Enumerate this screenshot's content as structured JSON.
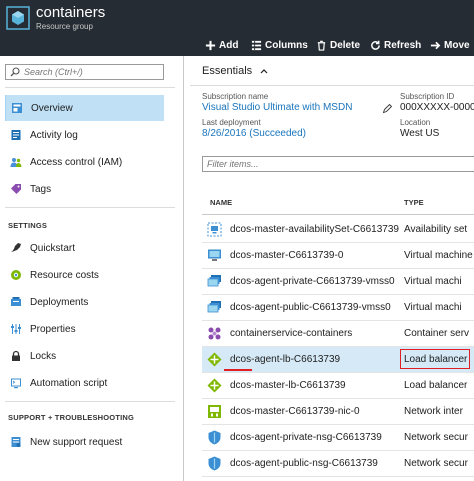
{
  "header": {
    "title": "containers",
    "subtitle": "Resource group",
    "toolbar": [
      {
        "label": "Add",
        "icon": "plus-icon"
      },
      {
        "label": "Columns",
        "icon": "columns-icon"
      },
      {
        "label": "Delete",
        "icon": "trash-icon"
      },
      {
        "label": "Refresh",
        "icon": "refresh-icon"
      },
      {
        "label": "Move",
        "icon": "arrow-right-icon"
      }
    ]
  },
  "sidebar": {
    "search_placeholder": "Search (Ctrl+/)",
    "items_top": [
      {
        "label": "Overview",
        "icon": "overview-icon",
        "color": "#3c8fd3"
      },
      {
        "label": "Activity log",
        "icon": "activity-log-icon",
        "color": "#1f6fb5"
      },
      {
        "label": "Access control (IAM)",
        "icon": "people-icon",
        "color": "#4a90d9"
      },
      {
        "label": "Tags",
        "icon": "tag-icon",
        "color": "#8a4cae"
      }
    ],
    "settings_label": "SETTINGS",
    "items_settings": [
      {
        "label": "Quickstart",
        "icon": "quickstart-icon",
        "color": "#333333"
      },
      {
        "label": "Resource costs",
        "icon": "costs-icon",
        "color": "#7fb800"
      },
      {
        "label": "Deployments",
        "icon": "deployments-icon",
        "color": "#3c8fd3"
      },
      {
        "label": "Properties",
        "icon": "properties-icon",
        "color": "#3c8fd3"
      },
      {
        "label": "Locks",
        "icon": "lock-icon",
        "color": "#333333"
      },
      {
        "label": "Automation script",
        "icon": "script-icon",
        "color": "#3c8fd3"
      }
    ],
    "support_label": "SUPPORT + TROUBLESHOOTING",
    "items_support": [
      {
        "label": "New support request",
        "icon": "support-icon",
        "color": "#3c8fd3"
      }
    ]
  },
  "essentials": {
    "title": "Essentials",
    "subscription_name_label": "Subscription name",
    "subscription_name": "Visual Studio Ultimate with MSDN",
    "subscription_id_label": "Subscription ID",
    "subscription_id": "000XXXXX-0000-",
    "last_deployment_label": "Last deployment",
    "last_deployment": "8/26/2016 (Succeeded)",
    "location_label": "Location",
    "location": "West US"
  },
  "resources": {
    "filter_placeholder": "Filter items...",
    "columns": {
      "name": "NAME",
      "type": "TYPE"
    },
    "rows": [
      {
        "name": "dcos-master-availabilitySet-C6613739",
        "type": "Availability set",
        "icon": "availability-set-icon"
      },
      {
        "name": "dcos-master-C6613739-0",
        "type": "Virtual machine",
        "icon": "vm-icon"
      },
      {
        "name": "dcos-agent-private-C6613739-vmss0",
        "type": "Virtual machi",
        "icon": "vmss-icon"
      },
      {
        "name": "dcos-agent-public-C6613739-vmss0",
        "type": "Virtual machi",
        "icon": "vmss-icon"
      },
      {
        "name": "containerservice-containers",
        "type": "Container serv",
        "icon": "container-service-icon"
      },
      {
        "name": "dcos-agent-lb-C6613739",
        "type": "Load balancer",
        "icon": "load-balancer-icon"
      },
      {
        "name": "dcos-master-lb-C6613739",
        "type": "Load balancer",
        "icon": "load-balancer-icon"
      },
      {
        "name": "dcos-master-C6613739-nic-0",
        "type": "Network inter",
        "icon": "nic-icon"
      },
      {
        "name": "dcos-agent-private-nsg-C6613739",
        "type": "Network secur",
        "icon": "nsg-icon"
      },
      {
        "name": "dcos-agent-public-nsg-C6613739",
        "type": "Network secur",
        "icon": "nsg-icon"
      }
    ]
  },
  "colors": {
    "header_bg": "#262c33",
    "accent": "#1a75bc",
    "selected_bg": "#bfe0f5",
    "highlight_red": "#e01e24"
  }
}
